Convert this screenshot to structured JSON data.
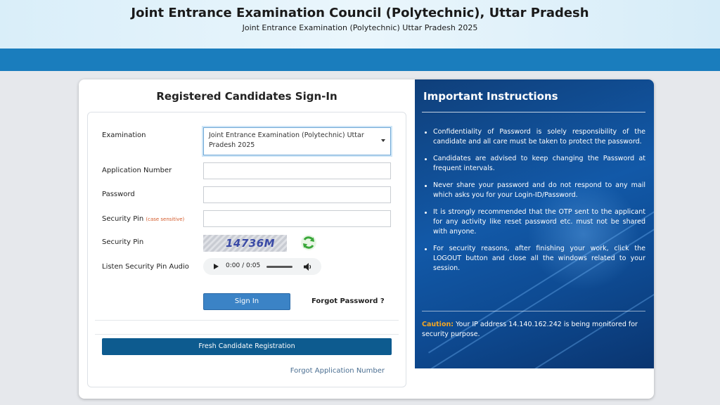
{
  "header": {
    "title": "Joint Entrance Examination Council (Polytechnic), Uttar Pradesh",
    "subtitle": "Joint Entrance Examination (Polytechnic) Uttar Pradesh 2025"
  },
  "signin": {
    "heading": "Registered Candidates Sign-In",
    "examination_label": "Examination",
    "examination_value": "Joint Entrance Examination (Polytechnic) Uttar Pradesh 2025",
    "application_number_label": "Application Number",
    "application_number_value": "",
    "password_label": "Password",
    "password_value": "",
    "security_pin_input_label": "Security Pin",
    "security_pin_hint": "(case sensitive)",
    "security_pin_input_value": "",
    "security_pin_image_label": "Security Pin",
    "captcha_text": "14736M",
    "audio_label": "Listen Security Pin Audio",
    "audio_time": "0:00 / 0:05",
    "signin_button": "Sign In",
    "forgot_password": "Forgot Password ?",
    "fresh_registration_button": "Fresh Candidate Registration",
    "forgot_application_number": "Forgot Application Number"
  },
  "instructions": {
    "title": "Important Instructions",
    "items": [
      "Confidentiality of Password is solely responsibility of the candidate and all care must be taken to protect the password.",
      "Candidates are advised to keep changing the Password at frequent intervals.",
      "Never share your password and do not respond to any mail which asks you for your Login-ID/Password.",
      "It is strongly recommended that the OTP sent to the applicant for any activity like reset password etc. must not be shared with anyone.",
      "For security reasons, after finishing your work, click the LOGOUT button and close all the windows related to your session."
    ],
    "caution_label": "Caution:",
    "caution_text": "Your IP address 14.140.162.242 is being monitored for security purpose."
  },
  "colors": {
    "header_band": "#1a7dbd",
    "instructions_bg": "#1259a8",
    "signin_button": "#3b83c6",
    "fresh_registration_button": "#0d5b8f",
    "caution_accent": "#f3a623"
  },
  "icons": {
    "refresh": "refresh-icon",
    "play": "play-icon",
    "volume": "volume-icon",
    "dropdown": "chevron-down-icon"
  }
}
